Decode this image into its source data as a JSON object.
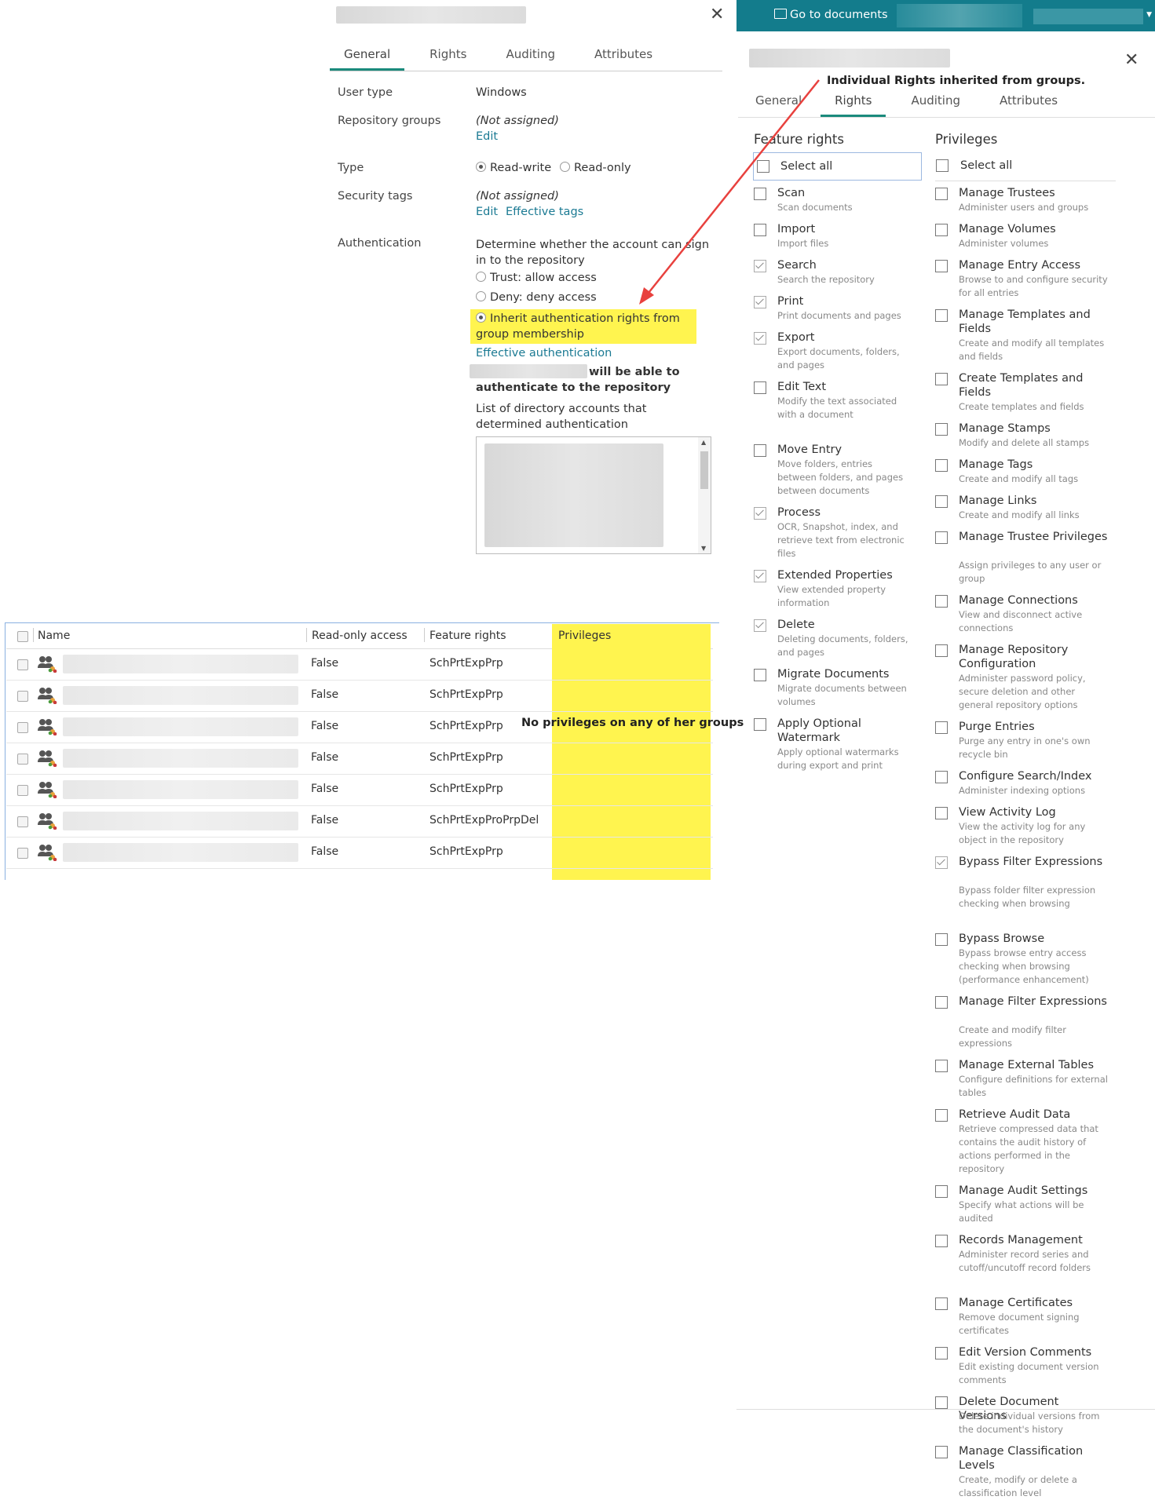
{
  "left_dialog": {
    "tabs": [
      "General",
      "Rights",
      "Auditing",
      "Attributes"
    ],
    "active_tab": "General",
    "close": "✕",
    "fields": {
      "user_type_label": "User type",
      "user_type_value": "Windows",
      "repo_groups_label": "Repository groups",
      "repo_groups_value": "(Not assigned)",
      "repo_groups_edit": "Edit",
      "type_label": "Type",
      "type_rw": "Read-write",
      "type_ro": "Read-only",
      "sec_tags_label": "Security tags",
      "sec_tags_value": "(Not assigned)",
      "sec_tags_edit": "Edit",
      "sec_tags_effective": "Effective tags",
      "auth_label": "Authentication",
      "auth_desc": "Determine whether the account can sign in to the repository",
      "auth_trust": "Trust: allow access",
      "auth_deny": "Deny: deny access",
      "auth_inherit": "Inherit authentication rights from group membership",
      "effective_auth": "Effective authentication",
      "will_be_able": "will be able to",
      "authenticate": "authenticate to the repository",
      "list_desc": "List of directory accounts that determined authentication"
    }
  },
  "table": {
    "headers": {
      "name": "Name",
      "readonly": "Read-only access",
      "feature": "Feature rights",
      "privileges": "Privileges"
    },
    "rows": [
      {
        "readonly": "False",
        "feature": "SchPrtExpPrp"
      },
      {
        "readonly": "False",
        "feature": "SchPrtExpPrp"
      },
      {
        "readonly": "False",
        "feature": "SchPrtExpPrp"
      },
      {
        "readonly": "False",
        "feature": "SchPrtExpPrp"
      },
      {
        "readonly": "False",
        "feature": "SchPrtExpPrp"
      },
      {
        "readonly": "False",
        "feature": "SchPrtExpProPrpDel"
      },
      {
        "readonly": "False",
        "feature": "SchPrtExpPrp"
      }
    ],
    "annotation": "No privileges on any of her groups"
  },
  "right_dialog": {
    "topbar_button": "Go to documents",
    "annotation": "Individual Rights inherited from groups.",
    "close": "✕",
    "tabs": [
      "General",
      "Rights",
      "Auditing",
      "Attributes"
    ],
    "active_tab": "Rights",
    "feature_title": "Feature rights",
    "privileges_title": "Privileges",
    "select_all": "Select all",
    "features": [
      {
        "t": "Scan",
        "d": "Scan documents",
        "c": false
      },
      {
        "t": "Import",
        "d": "Import files",
        "c": false
      },
      {
        "t": "Search",
        "d": "Search the repository",
        "c": true
      },
      {
        "t": "Print",
        "d": "Print documents and pages",
        "c": true
      },
      {
        "t": "Export",
        "d": "Export documents, folders, and pages",
        "c": true
      },
      {
        "t": "Edit Text",
        "d": "Modify the text associated with a document",
        "c": false
      },
      {
        "t": "Move Entry",
        "d": "Move folders, entries between folders, and pages between documents",
        "c": false
      },
      {
        "t": "Process",
        "d": "OCR, Snapshot, index, and retrieve text from electronic files",
        "c": true
      },
      {
        "t": "Extended Properties",
        "d": "View extended property information",
        "c": true
      },
      {
        "t": "Delete",
        "d": "Deleting documents, folders, and pages",
        "c": true
      },
      {
        "t": "Migrate Documents",
        "d": "Migrate documents between volumes",
        "c": false
      },
      {
        "t": "Apply Optional Watermark",
        "d": "Apply optional watermarks during export and print",
        "c": false
      }
    ],
    "privileges": [
      {
        "t": "Manage Trustees",
        "d": "Administer users and groups",
        "c": false
      },
      {
        "t": "Manage Volumes",
        "d": "Administer volumes",
        "c": false
      },
      {
        "t": "Manage Entry Access",
        "d": "Browse to and configure security for all entries",
        "c": false
      },
      {
        "t": "Manage Templates and Fields",
        "d": "Create and modify all templates and fields",
        "c": false
      },
      {
        "t": "Create Templates and Fields",
        "d": "Create templates and fields",
        "c": false
      },
      {
        "t": "Manage Stamps",
        "d": "Modify and delete all stamps",
        "c": false
      },
      {
        "t": "Manage Tags",
        "d": "Create and modify all tags",
        "c": false
      },
      {
        "t": "Manage Links",
        "d": "Create and modify all links",
        "c": false
      },
      {
        "t": "Manage Trustee Privileges",
        "d": "Assign privileges to any user or group",
        "c": false
      },
      {
        "t": "Manage Connections",
        "d": "View and disconnect active connections",
        "c": false
      },
      {
        "t": "Manage Repository Configuration",
        "d": "Administer password policy, secure deletion and other general repository options",
        "c": false
      },
      {
        "t": "Purge Entries",
        "d": "Purge any entry in one's own recycle bin",
        "c": false
      },
      {
        "t": "Configure Search/Index",
        "d": "Administer indexing options",
        "c": false
      },
      {
        "t": "View Activity Log",
        "d": "View the activity log for any object in the repository",
        "c": false
      },
      {
        "t": "Bypass Filter Expressions",
        "d": "Bypass folder filter expression checking when browsing",
        "c": true
      },
      {
        "t": "Bypass Browse",
        "d": "Bypass browse entry access checking when browsing (performance enhancement)",
        "c": false
      },
      {
        "t": "Manage Filter Expressions",
        "d": "Create and modify filter expressions",
        "c": false
      },
      {
        "t": "Manage External Tables",
        "d": "Configure definitions for external tables",
        "c": false
      },
      {
        "t": "Retrieve Audit Data",
        "d": "Retrieve compressed data that contains the audit history of actions performed in the repository",
        "c": false
      },
      {
        "t": "Manage Audit Settings",
        "d": "Specify what actions will be audited",
        "c": false
      },
      {
        "t": "Records Management",
        "d": "Administer record series and cutoff/uncutoff record folders",
        "c": false
      },
      {
        "t": "Manage Certificates",
        "d": "Remove document signing certificates",
        "c": false
      },
      {
        "t": "Edit Version Comments",
        "d": "Edit existing document version comments",
        "c": false
      },
      {
        "t": "Delete Document Versions",
        "d": "Delete individual versions from the document's history",
        "c": false
      },
      {
        "t": "Manage Classification Levels",
        "d": "Create, modify or delete a classification level",
        "c": false
      }
    ]
  }
}
